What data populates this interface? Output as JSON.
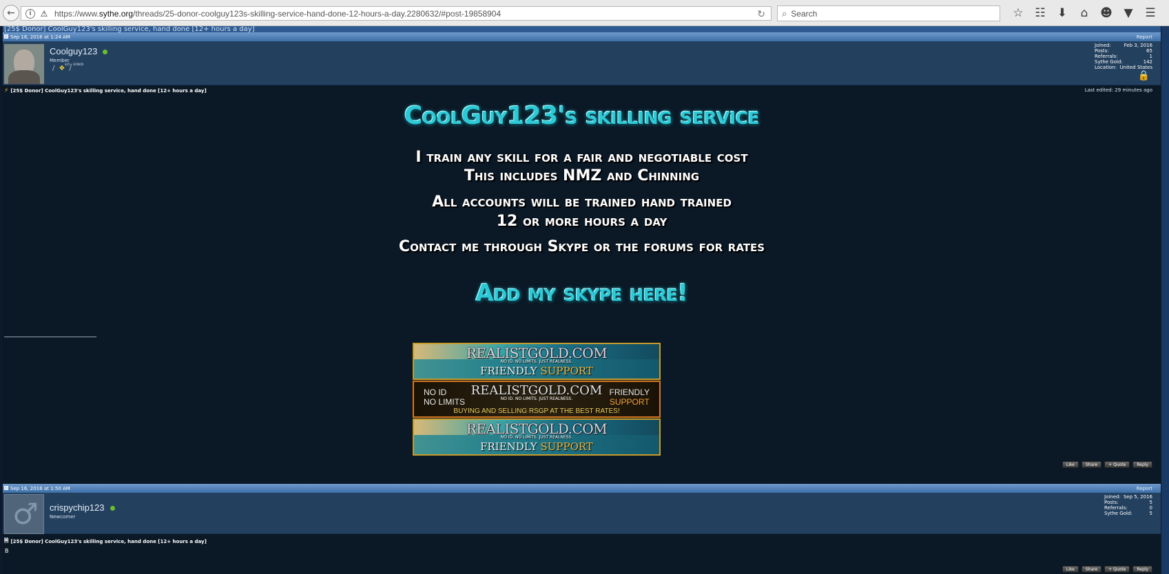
{
  "browser": {
    "url_prefix": "https://www.",
    "url_host": "sythe.org",
    "url_path": "/threads/25-donor-coolguy123s-skilling-service-hand-done-12-hours-a-day.2280632/#post-19858904",
    "search_placeholder": "Search"
  },
  "thread": {
    "title_strip": "[25$ Donor] CoolGuy123's skilling service, hand done [12+ hours a day]"
  },
  "post1": {
    "date": "Sep 16, 2016 at 1:24 AM",
    "report": "Report",
    "username": "Coolguy123",
    "rank": "Member",
    "donor_label": "$25+ DONOR",
    "stats": [
      {
        "label": "Joined:",
        "value": "Feb 3, 2016"
      },
      {
        "label": "Posts:",
        "value": "65"
      },
      {
        "label": "Referrals:",
        "value": "1"
      },
      {
        "label": "Sythe Gold:",
        "value": "142"
      },
      {
        "label": "Location:",
        "value": "United States"
      }
    ],
    "title": "[25$ Donor] CoolGuy123's skilling service, hand done [12+ hours a day]",
    "edited": "Last edited: 29 minutes ago",
    "heading": "CoolGuy123's skilling service",
    "line1": "I train any skill for a fair and negotiable cost",
    "line2": "This includes NMZ and Chinning",
    "line3": "All accounts will be trained hand trained",
    "line4": "12 or more hours a day",
    "line5": "Contact me through Skype or the forums for rates",
    "skype": "Add my skype here!",
    "actions": [
      "Like",
      "Share",
      "+ Quote",
      "Reply"
    ]
  },
  "banners": {
    "title": "REALISTGOLD.COM",
    "subtitle": "NO ID. NO LIMITS. JUST REALNESS.",
    "friendly": "FRIENDLY",
    "support": "SUPPORT",
    "no_id": "NO ID",
    "no_limits": "NO LIMITS",
    "buying": "BUYING AND SELLING RSGP AT THE BEST RATES!"
  },
  "post2": {
    "date": "Sep 16, 2016 at 1:50 AM",
    "report": "Report",
    "username": "crispychip123",
    "rank": "Newcomer",
    "stats": [
      {
        "label": "Joined:",
        "value": "Sep 5, 2016"
      },
      {
        "label": "Posts:",
        "value": "5"
      },
      {
        "label": "Referrals:",
        "value": "0"
      },
      {
        "label": "Sythe Gold:",
        "value": "5"
      }
    ],
    "title": "[25$ Donor] CoolGuy123's skilling service, hand done [12+ hours a day]",
    "body": "B",
    "actions": [
      "Like",
      "Share",
      "+ Quote",
      "Reply"
    ]
  }
}
